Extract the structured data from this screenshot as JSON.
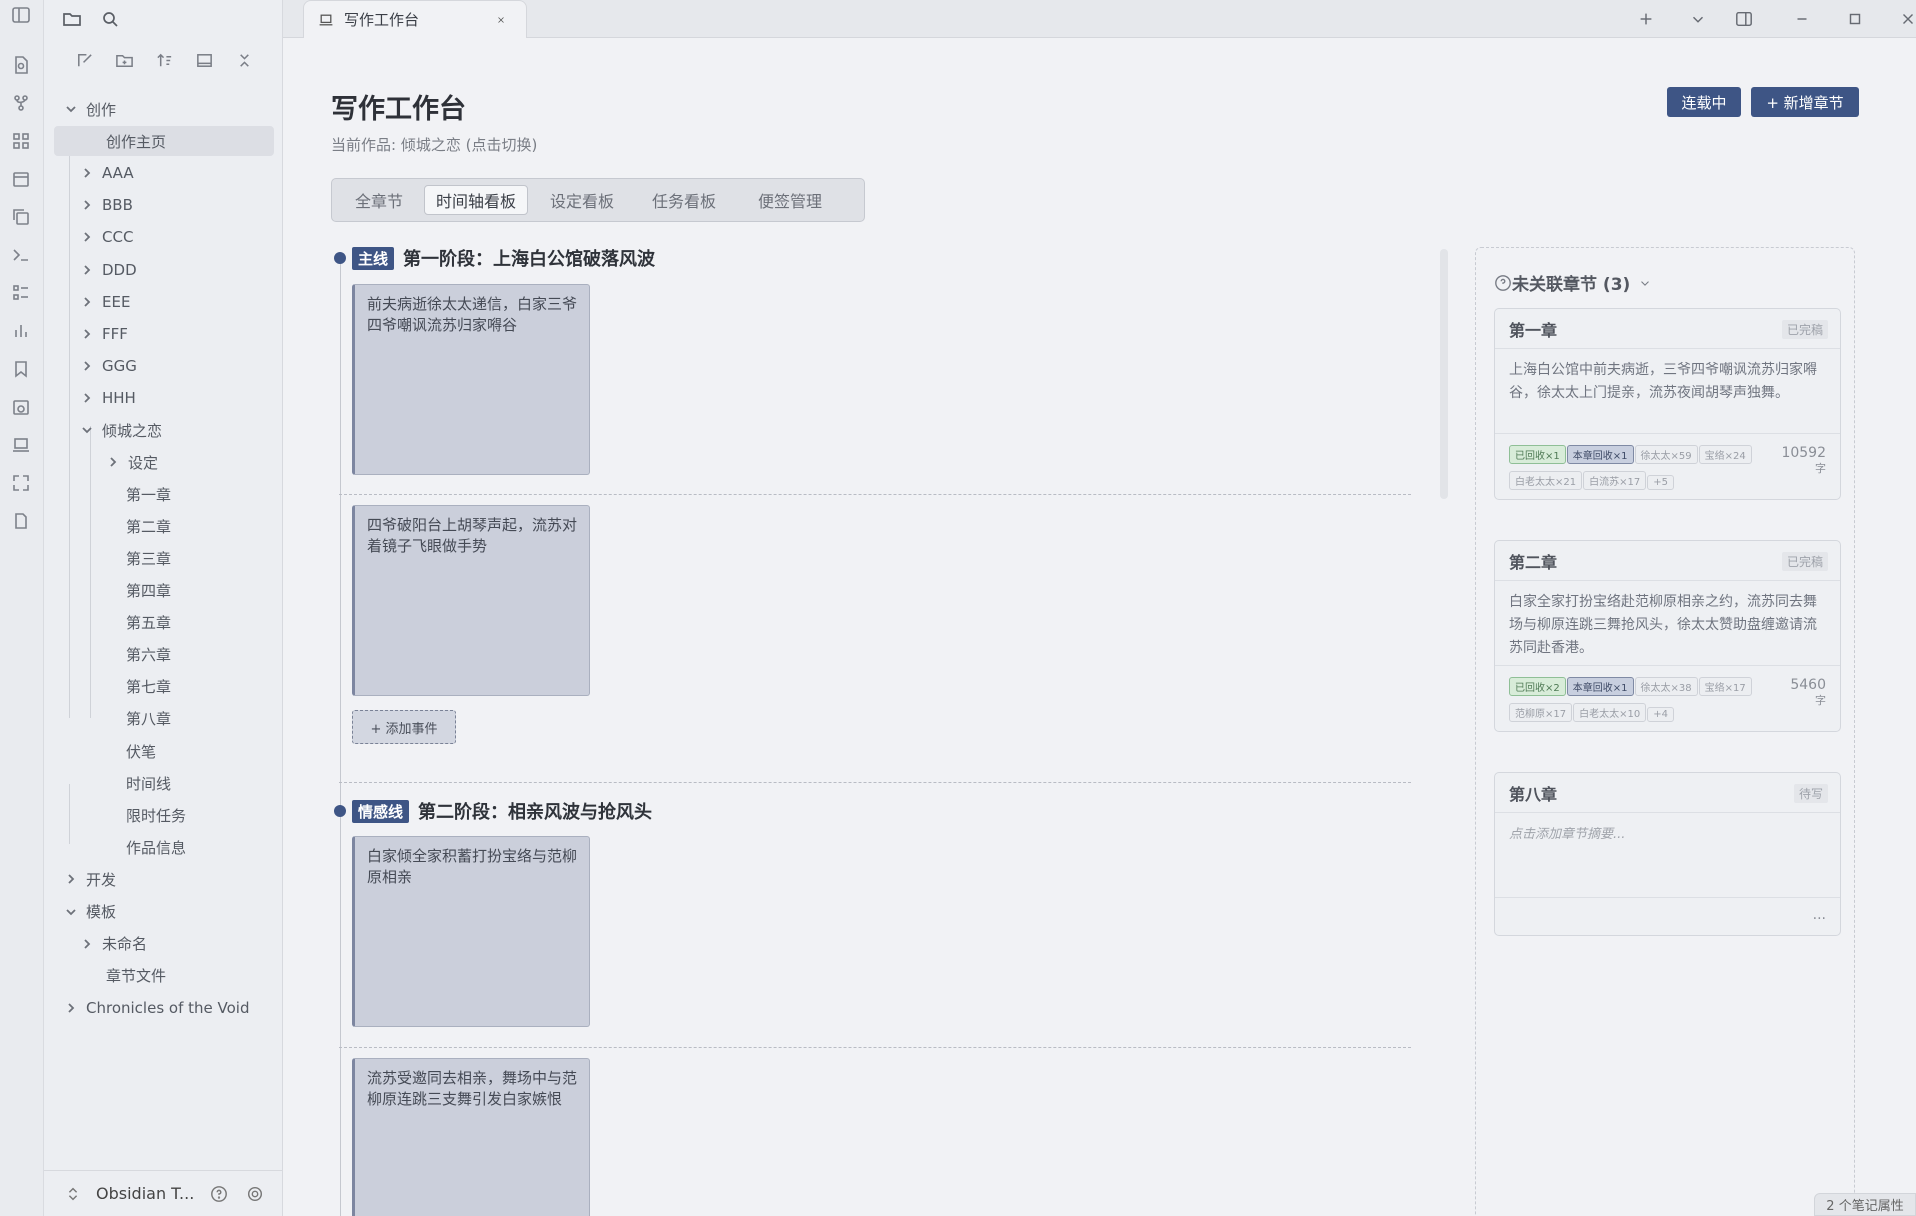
{
  "tab": {
    "title": "写作工作台"
  },
  "sidebar": {
    "vault_name": "Obsidian T...",
    "tree": [
      {
        "label": "创作",
        "chevron": "down"
      },
      {
        "label": "创作主页",
        "chevron": "none",
        "selected": true
      },
      {
        "label": "AAA",
        "chevron": "right"
      },
      {
        "label": "BBB",
        "chevron": "right"
      },
      {
        "label": "CCC",
        "chevron": "right"
      },
      {
        "label": "DDD",
        "chevron": "right"
      },
      {
        "label": "EEE",
        "chevron": "right"
      },
      {
        "label": "FFF",
        "chevron": "right"
      },
      {
        "label": "GGG",
        "chevron": "right"
      },
      {
        "label": "HHH",
        "chevron": "right"
      },
      {
        "label": "倾城之恋",
        "chevron": "down"
      },
      {
        "label": "设定",
        "chevron": "right"
      },
      {
        "label": "第一章",
        "chevron": "none"
      },
      {
        "label": "第二章",
        "chevron": "none"
      },
      {
        "label": "第三章",
        "chevron": "none"
      },
      {
        "label": "第四章",
        "chevron": "none"
      },
      {
        "label": "第五章",
        "chevron": "none"
      },
      {
        "label": "第六章",
        "chevron": "none"
      },
      {
        "label": "第七章",
        "chevron": "none"
      },
      {
        "label": "第八章",
        "chevron": "none"
      },
      {
        "label": "伏笔",
        "chevron": "none"
      },
      {
        "label": "时间线",
        "chevron": "none"
      },
      {
        "label": "限时任务",
        "chevron": "none"
      },
      {
        "label": "作品信息",
        "chevron": "none"
      },
      {
        "label": "开发",
        "chevron": "right"
      },
      {
        "label": "模板",
        "chevron": "down"
      },
      {
        "label": "未命名",
        "chevron": "right"
      },
      {
        "label": "章节文件",
        "chevron": "none"
      },
      {
        "label": "Chronicles of the Void",
        "chevron": "right"
      }
    ]
  },
  "main": {
    "title": "写作工作台",
    "subtitle": "当前作品: 倾城之恋 (点击切换)",
    "btn_serial": "连载中",
    "btn_new_chapter": "+ 新增章节",
    "view_tabs": [
      "全章节",
      "时间轴看板",
      "设定看板",
      "任务看板",
      "便签管理"
    ],
    "active_view": "时间轴看板",
    "stages": [
      {
        "badge": "主线",
        "title": "第一阶段：上海白公馆破落风波",
        "events": [
          "前夫病逝徐太太递信，白家三爷四爷嘲讽流苏归家嘚谷",
          "四爷破阳台上胡琴声起，流苏对着镜子飞眼做手势"
        ],
        "add_event": "+ 添加事件"
      },
      {
        "badge": "情感线",
        "title": "第二阶段：相亲风波与抢风头",
        "events": [
          "白家倾全家积蓄打扮宝络与范柳原相亲",
          "流苏受邀同去相亲，舞场中与范柳原连跳三支舞引发白家嫉恨"
        ]
      }
    ]
  },
  "right_panel": {
    "title": "未关联章节 (3)",
    "chapters": [
      {
        "name": "第一章",
        "status": "已完稿",
        "summary": "上海白公馆中前夫病逝，三爷四爷嘲讽流苏归家嘚谷，徐太太上门提亲，流苏夜闻胡琴声独舞。",
        "tags": [
          {
            "text": "已回收×1",
            "style": "g"
          },
          {
            "text": "本章回收×1",
            "style": "b"
          },
          {
            "text": "徐太太×59",
            "style": "n"
          },
          {
            "text": "宝络×24",
            "style": "n"
          },
          {
            "text": "白老太太×21",
            "style": "n"
          },
          {
            "text": "白流苏×17",
            "style": "n"
          },
          {
            "text": "+5",
            "style": "n"
          }
        ],
        "word_count": "10592",
        "unit": "字"
      },
      {
        "name": "第二章",
        "status": "已完稿",
        "summary": "白家全家打扮宝络赴范柳原相亲之约，流苏同去舞场与柳原连跳三舞抢风头，徐太太赞助盘缠邀请流苏同赴香港。",
        "tags": [
          {
            "text": "已回收×2",
            "style": "g"
          },
          {
            "text": "本章回收×1",
            "style": "b"
          },
          {
            "text": "徐太太×38",
            "style": "n"
          },
          {
            "text": "宝络×17",
            "style": "n"
          },
          {
            "text": "范柳原×17",
            "style": "n"
          },
          {
            "text": "白老太太×10",
            "style": "n"
          },
          {
            "text": "+4",
            "style": "n"
          }
        ],
        "word_count": "5460",
        "unit": "字"
      },
      {
        "name": "第八章",
        "status": "待写",
        "summary": "点击添加章节摘要...",
        "tags": [],
        "word_count": "",
        "unit": "",
        "more": "..."
      }
    ]
  },
  "status_bar": {
    "text": "2 个笔记属性"
  }
}
